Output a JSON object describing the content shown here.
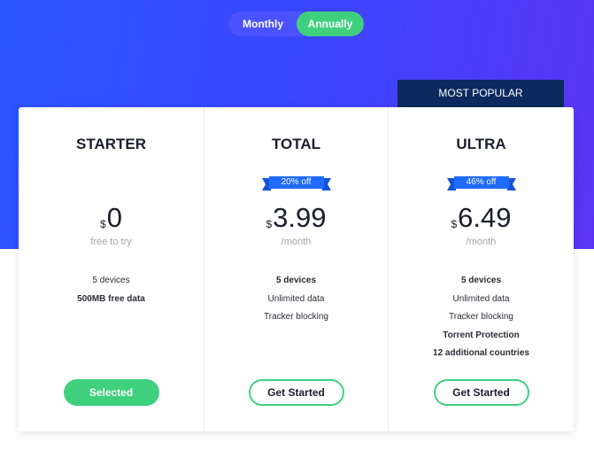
{
  "billing_toggle": {
    "monthly_label": "Monthly",
    "annually_label": "Annually",
    "selected": "Annually"
  },
  "badge": {
    "most_popular": "MOST POPULAR"
  },
  "plans": [
    {
      "name": "STARTER",
      "currency": "$",
      "price": "0",
      "price_note": "free to try",
      "features": [
        "5 devices",
        "500MB free data"
      ],
      "button_label": "Selected"
    },
    {
      "name": "TOTAL",
      "discount": "20% off",
      "currency": "$",
      "price": "3.99",
      "price_note": "/month",
      "features": [
        "5 devices",
        "Unlimited data",
        "Tracker blocking"
      ],
      "button_label": "Get Started"
    },
    {
      "name": "ULTRA",
      "discount": "46% off",
      "currency": "$",
      "price": "6.49",
      "price_note": "/month",
      "features": [
        "5 devices",
        "Unlimited data",
        "Tracker blocking",
        "Torrent Protection",
        "12 additional countries"
      ],
      "button_label": "Get Started"
    }
  ],
  "colors": {
    "hero_gradient_start": "#2a55ff",
    "hero_gradient_end": "#5b35f5",
    "accent_green": "#3fd07d",
    "ribbon_blue": "#1f6bff",
    "popular_badge": "#0d2a5e"
  }
}
